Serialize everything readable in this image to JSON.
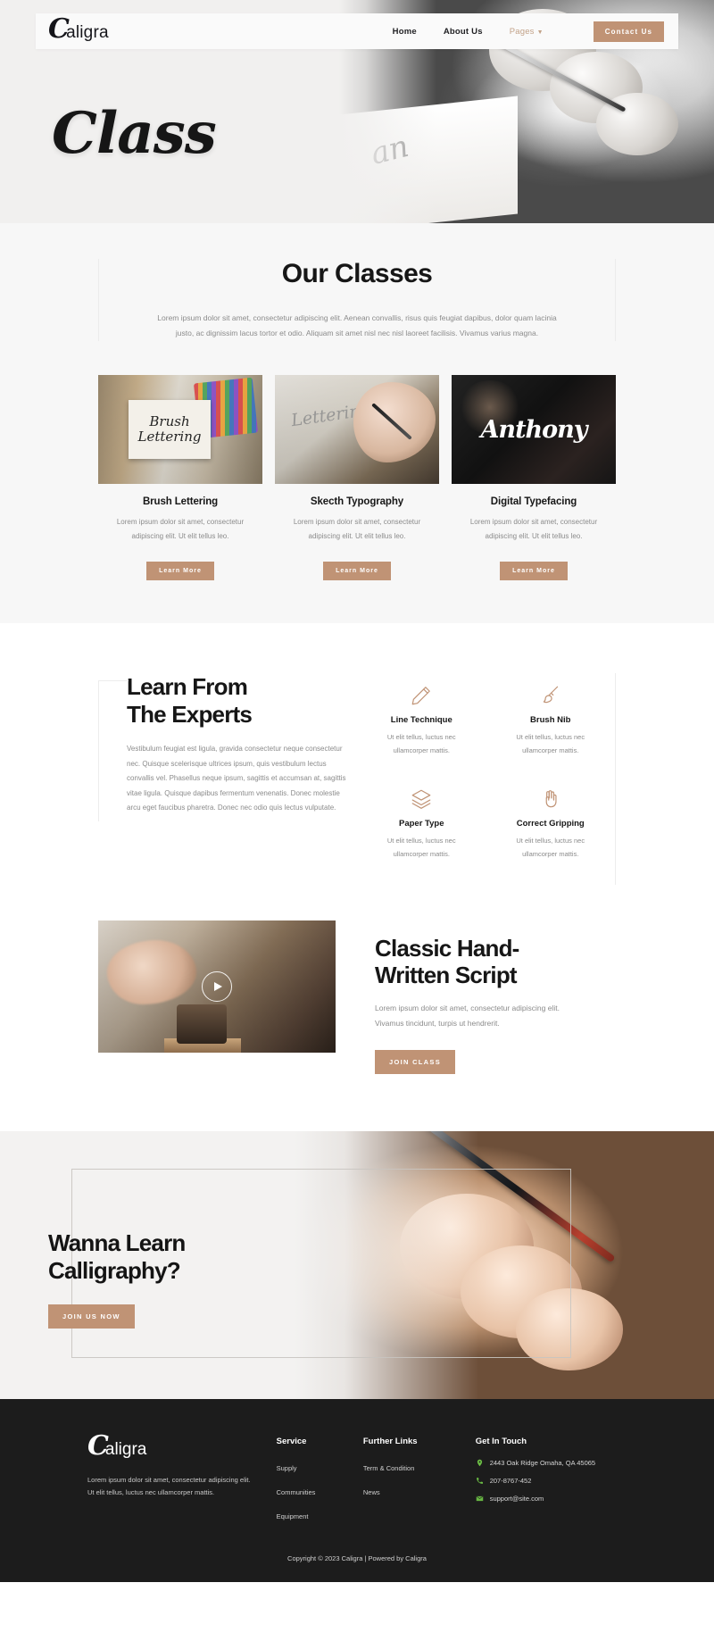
{
  "brand": {
    "mark": "C",
    "rest": "aligra",
    "full": "Caligra"
  },
  "nav": {
    "items": [
      {
        "label": "Home",
        "muted": false
      },
      {
        "label": "About Us",
        "muted": false
      },
      {
        "label": "Pages",
        "muted": true,
        "caret": "chevron-down-icon"
      }
    ],
    "cta_label": "Contact Us"
  },
  "hero": {
    "title": "Class"
  },
  "classes": {
    "title": "Our Classes",
    "subtitle": "Lorem ipsum dolor sit amet, consectetur adipiscing elit. Aenean convallis, risus quis feugiat dapibus, dolor quam lacinia justo, ac dignissim lacus tortor et odio. Aliquam sit amet nisl nec nisl laoreet facilisis. Vivamus varius magna.",
    "cards": [
      {
        "title": "Brush Lettering",
        "text": "Lorem ipsum dolor sit amet, consectetur adipiscing elit. Ut elit tellus leo.",
        "button": "Learn More",
        "image_caption": "Brush Lettering"
      },
      {
        "title": "Skecth Typography",
        "text": "Lorem ipsum dolor sit amet, consectetur adipiscing elit. Ut elit tellus leo.",
        "button": "Learn More",
        "image_caption": "Lettering"
      },
      {
        "title": "Digital Typefacing",
        "text": "Lorem ipsum dolor sit amet, consectetur adipiscing elit. Ut elit tellus leo.",
        "button": "Learn More",
        "image_caption": "Anthony"
      }
    ]
  },
  "experts": {
    "title_line1": "Learn From",
    "title_line2": "The Experts",
    "text": "Vestibulum feugiat est ligula, gravida consectetur neque consectetur nec. Quisque scelerisque ultrices ipsum, quis vestibulum lectus convallis vel. Phasellus neque ipsum, sagittis et accumsan at, sagittis vitae ligula. Quisque dapibus fermentum venenatis. Donec molestie arcu eget faucibus pharetra. Donec nec odio quis lectus vulputate.",
    "features": [
      {
        "icon": "pencil-icon",
        "title": "Line Technique",
        "text": "Ut elit tellus, luctus nec ullamcorper mattis."
      },
      {
        "icon": "brush-icon",
        "title": "Brush Nib",
        "text": "Ut elit tellus, luctus nec ullamcorper mattis."
      },
      {
        "icon": "layers-icon",
        "title": "Paper Type",
        "text": "Ut elit tellus, luctus nec ullamcorper mattis."
      },
      {
        "icon": "hand-icon",
        "title": "Correct Gripping",
        "text": "Ut elit tellus, luctus nec ullamcorper mattis."
      }
    ]
  },
  "script_section": {
    "title_line1": "Classic Hand-",
    "title_line2": "Written Script",
    "text": "Lorem ipsum dolor sit amet, consectetur adipiscing elit. Vivamus tincidunt, turpis ut hendrerit.",
    "button": "JOIN CLASS",
    "play_icon": "play-icon"
  },
  "cta": {
    "title_line1": "Wanna Learn",
    "title_line2": "Calligraphy?",
    "button": "JOIN US NOW"
  },
  "footer": {
    "description": "Lorem ipsum dolor sit amet, consectetur adipiscing elit. Ut elit tellus, luctus nec ullamcorper mattis.",
    "columns": [
      {
        "head": "Service",
        "items": [
          "Supply",
          "Communities",
          "Equipment"
        ]
      },
      {
        "head": "Further Links",
        "items": [
          "Term & Condition",
          "News"
        ]
      }
    ],
    "touch": {
      "head": "Get In Touch",
      "rows": [
        {
          "icon": "location-pin-icon",
          "text": "2443 Oak Ridge Omaha, QA 45065"
        },
        {
          "icon": "phone-icon",
          "text": "207-8767-452"
        },
        {
          "icon": "mail-icon",
          "text": "support@site.com"
        }
      ]
    },
    "copyright": "Copyright © 2023 Caligra | Powered by Caligra"
  },
  "colors": {
    "accent": "#c09375",
    "dark": "#1c1c1c",
    "muted_text": "#8b8b8b",
    "footer_icon_green": "#6cbf45",
    "section_bg": "#f7f7f7"
  }
}
